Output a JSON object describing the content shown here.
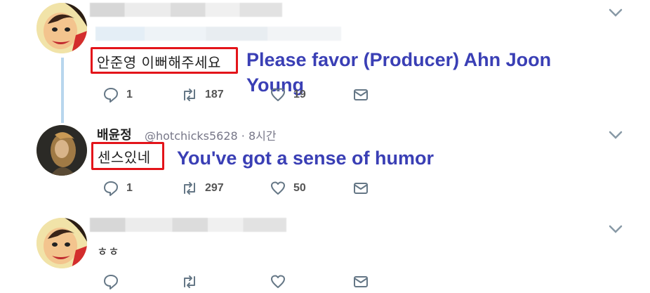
{
  "tweets": [
    {
      "text": "안준영 이뻐해주세요",
      "translation": "Please favor (Producer) Ahn Joon Young",
      "actions": {
        "reply": "1",
        "retweet": "187",
        "like": "19"
      }
    },
    {
      "name": "배윤정",
      "handle": "@hotchicks5628 · 8시간",
      "text": "센스있네",
      "translation": "You've got a sense of humor",
      "actions": {
        "reply": "1",
        "retweet": "297",
        "like": "50"
      }
    },
    {
      "text": "ㅎㅎ"
    }
  ],
  "colors": {
    "highlight_box": "#e3141a",
    "translation_text": "#3a3fb5",
    "thread_line": "#b8d6ee"
  }
}
